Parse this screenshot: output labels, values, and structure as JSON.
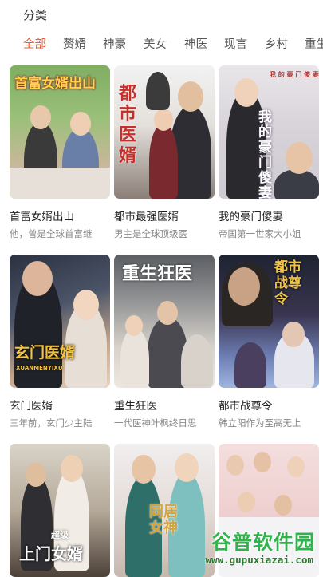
{
  "header": {
    "title": "分类"
  },
  "tabs": [
    {
      "label": "全部",
      "active": true
    },
    {
      "label": "赘婿",
      "active": false
    },
    {
      "label": "神豪",
      "active": false
    },
    {
      "label": "美女",
      "active": false
    },
    {
      "label": "神医",
      "active": false
    },
    {
      "label": "现言",
      "active": false
    },
    {
      "label": "乡村",
      "active": false
    },
    {
      "label": "重生",
      "active": false
    }
  ],
  "dramas": [
    {
      "name": "首富女婿出山",
      "desc": "他，曾是全球首富继",
      "poster_text": "首富女婿出山"
    },
    {
      "name": "都市最强医婿",
      "desc": "男主是全球顶级医",
      "poster_text": "都市医婿"
    },
    {
      "name": "我的豪门傻妻",
      "desc": "帝国第一世家大小姐",
      "poster_text": "我的豪门傻妻"
    },
    {
      "name": "玄门医婿",
      "desc": "三年前，玄门少主陆",
      "poster_text": "玄门医婿",
      "poster_sub": "XUANMENYIXU"
    },
    {
      "name": "重生狂医",
      "desc": "一代医神叶枫终日思",
      "poster_text": "重生狂医"
    },
    {
      "name": "都市战尊令",
      "desc": "韩立阳作为至高无上",
      "poster_text": "都市战尊令"
    },
    {
      "name": "",
      "desc": "",
      "poster_text": "上门女婿",
      "poster_sub": "超级"
    },
    {
      "name": "",
      "desc": "",
      "poster_text": "同居女神"
    },
    {
      "name": "",
      "desc": "",
      "poster_text": ""
    }
  ],
  "watermark": {
    "brand": "谷普软件园",
    "url": "www.gupuxiazai.com"
  },
  "colors": {
    "accent": "#f05a3a"
  }
}
